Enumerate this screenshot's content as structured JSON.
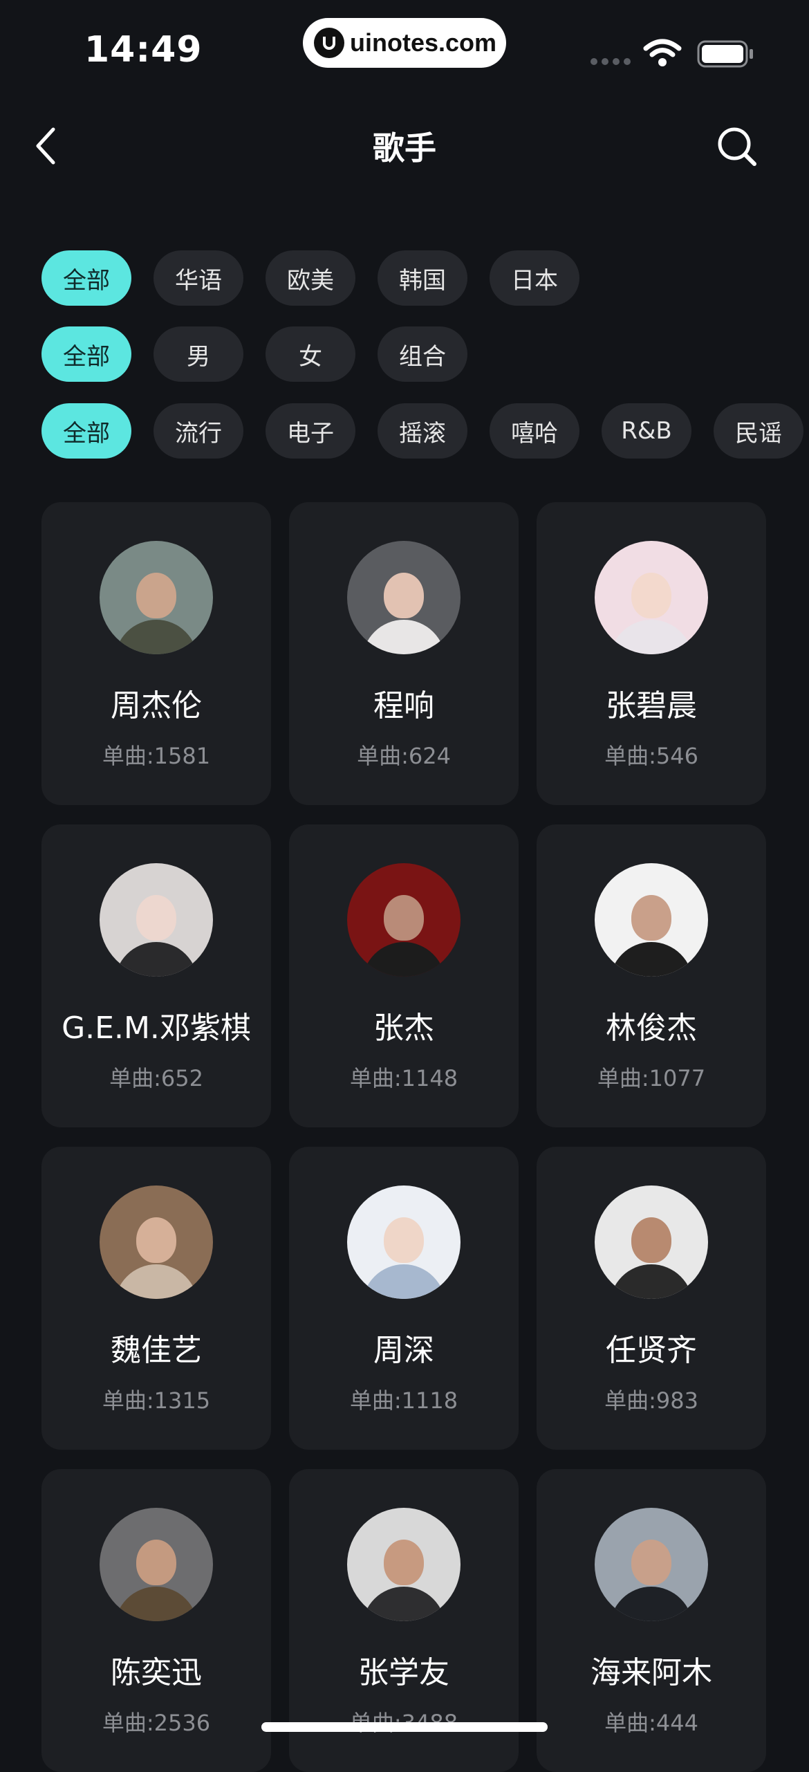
{
  "status_bar": {
    "time": "14:49",
    "watermark": "uinotes.com"
  },
  "nav": {
    "title": "歌手"
  },
  "filters": {
    "region": [
      {
        "label": "全部",
        "active": true
      },
      {
        "label": "华语",
        "active": false
      },
      {
        "label": "欧美",
        "active": false
      },
      {
        "label": "韩国",
        "active": false
      },
      {
        "label": "日本",
        "active": false
      }
    ],
    "gender": [
      {
        "label": "全部",
        "active": true
      },
      {
        "label": "男",
        "active": false
      },
      {
        "label": "女",
        "active": false
      },
      {
        "label": "组合",
        "active": false
      }
    ],
    "genre": [
      {
        "label": "全部",
        "active": true
      },
      {
        "label": "流行",
        "active": false
      },
      {
        "label": "电子",
        "active": false
      },
      {
        "label": "摇滚",
        "active": false
      },
      {
        "label": "嘻哈",
        "active": false
      },
      {
        "label": "R&B",
        "active": false
      },
      {
        "label": "民谣",
        "active": false
      }
    ]
  },
  "artists": [
    {
      "name": "周杰伦",
      "songs": "单曲:1581",
      "avatar_bg": "#7a8a86",
      "skin": "#caa48c",
      "cloth": "#4b5042"
    },
    {
      "name": "程响",
      "songs": "单曲:624",
      "avatar_bg": "#5a5c60",
      "skin": "#e2c2b2",
      "cloth": "#e8e6e6"
    },
    {
      "name": "张碧晨",
      "songs": "单曲:546",
      "avatar_bg": "#f1dde4",
      "skin": "#f3d9cd",
      "cloth": "#e9e4ea"
    },
    {
      "name": "G.E.M.邓紫棋",
      "songs": "单曲:652",
      "avatar_bg": "#d7d3d2",
      "skin": "#edd7cf",
      "cloth": "#2a2a2c"
    },
    {
      "name": "张杰",
      "songs": "单曲:1148",
      "avatar_bg": "#7a1414",
      "skin": "#b98b78",
      "cloth": "#1c1c1c"
    },
    {
      "name": "林俊杰",
      "songs": "单曲:1077",
      "avatar_bg": "#f2f2f2",
      "skin": "#c9a08a",
      "cloth": "#1e1e1e"
    },
    {
      "name": "魏佳艺",
      "songs": "单曲:1315",
      "avatar_bg": "#8a6d55",
      "skin": "#d6b098",
      "cloth": "#c9b7a5"
    },
    {
      "name": "周深",
      "songs": "单曲:1118",
      "avatar_bg": "#eceff4",
      "skin": "#efd6c8",
      "cloth": "#a7b8cf"
    },
    {
      "name": "任贤齐",
      "songs": "单曲:983",
      "avatar_bg": "#e8e8e8",
      "skin": "#b88a70",
      "cloth": "#2a2a2a"
    },
    {
      "name": "陈奕迅",
      "songs": "单曲:2536",
      "avatar_bg": "#6d6d6f",
      "skin": "#c49a80",
      "cloth": "#5c4b36"
    },
    {
      "name": "张学友",
      "songs": "单曲:3488",
      "avatar_bg": "#d8d8d8",
      "skin": "#c79a80",
      "cloth": "#2e2e30"
    },
    {
      "name": "海来阿木",
      "songs": "单曲:444",
      "avatar_bg": "#9aa3ad",
      "skin": "#c8a08a",
      "cloth": "#1e2126"
    }
  ]
}
